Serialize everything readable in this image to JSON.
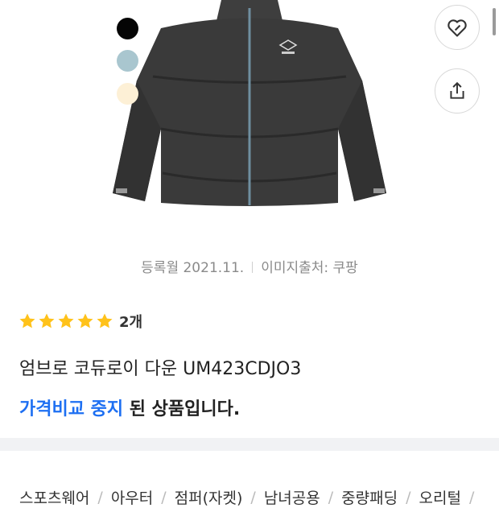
{
  "product": {
    "register_date": "등록월 2021.11.",
    "image_source": "이미지출처: 쿠팡",
    "rating": 5,
    "review_count": "2개",
    "title": "엄브로 코듀로이 다운 UM423CDJO3",
    "notice_highlight": "가격비교 중지",
    "notice_rest": " 된 상품입니다.",
    "accent_color": "#1d6ff2",
    "star_color": "#ffc21a"
  },
  "color_swatches": [
    "#050505",
    "#a9c6cf",
    "#fdf0d6"
  ],
  "actions": [
    {
      "name": "wishlist",
      "icon": "heart-icon"
    },
    {
      "name": "share",
      "icon": "share-icon"
    }
  ],
  "categories": [
    "스포츠웨어",
    "아우터",
    "점퍼(자켓)",
    "남녀공용",
    "중량패딩",
    "오리털"
  ]
}
